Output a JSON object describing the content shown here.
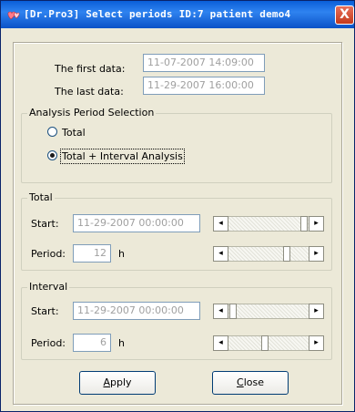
{
  "window": {
    "title": "[Dr.Pro3] Select periods  ID:7 patient demo4",
    "close_label": "X"
  },
  "data_range": {
    "first_label": "The first data:",
    "first_value": "11-07-2007 14:09:00",
    "last_label": "The last data:",
    "last_value": "11-29-2007 16:00:00"
  },
  "analysis": {
    "legend": "Analysis Period Selection",
    "options": [
      "Total",
      "Total + Interval Analysis"
    ],
    "selected": "Total + Interval Analysis"
  },
  "total": {
    "legend": "Total",
    "start_label": "Start:",
    "start_value": "11-29-2007 00:00:00",
    "start_position": 1.0,
    "period_label": "Period:",
    "period_value": "12",
    "period_unit": "h",
    "period_position": 0.75
  },
  "interval": {
    "legend": "Interval",
    "start_label": "Start:",
    "start_value": "11-29-2007 00:00:00",
    "start_position": 0.0,
    "period_label": "Period:",
    "period_value": "6",
    "period_unit": "h",
    "period_position": 0.45
  },
  "buttons": {
    "apply_underline": "A",
    "apply_rest": "pply",
    "close_underline": "C",
    "close_rest": "lose"
  },
  "icons": {
    "title_icon": "hearts-icon",
    "scroll_left": "◂",
    "scroll_right": "▸"
  }
}
